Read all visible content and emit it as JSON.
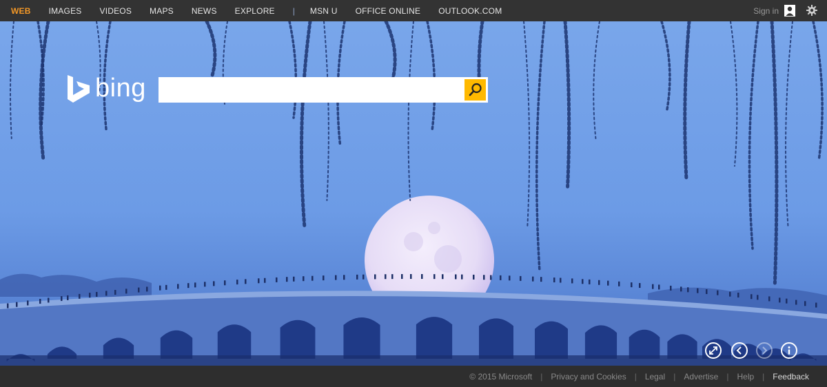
{
  "nav": {
    "items": [
      {
        "label": "WEB",
        "active": true
      },
      {
        "label": "IMAGES"
      },
      {
        "label": "VIDEOS"
      },
      {
        "label": "MAPS"
      },
      {
        "label": "NEWS"
      },
      {
        "label": "EXPLORE"
      }
    ],
    "separator": "|",
    "extra_items": [
      {
        "label": "MSN U"
      },
      {
        "label": "OFFICE ONLINE"
      },
      {
        "label": "OUTLOOK.COM"
      }
    ],
    "signin_label": "Sign in",
    "icons": [
      "user-icon",
      "gear-icon"
    ]
  },
  "logo": {
    "wordmark": "bing",
    "icon": "bing-b-logo-icon"
  },
  "search": {
    "value": "",
    "button_icon": "search-icon",
    "button_color": "#ffb900"
  },
  "image_controls": {
    "icons": [
      "expand-icon",
      "previous-icon",
      "next-icon",
      "info-icon"
    ]
  },
  "footer": {
    "copyright": "© 2015 Microsoft",
    "links": [
      "Privacy and Cookies",
      "Legal",
      "Advertise",
      "Help"
    ],
    "feedback": "Feedback",
    "separator": "|"
  },
  "colors": {
    "active_nav": "#f29727",
    "topbar": "#333333",
    "footer": "#2e2e2e",
    "sky": "#6f9fe8"
  }
}
